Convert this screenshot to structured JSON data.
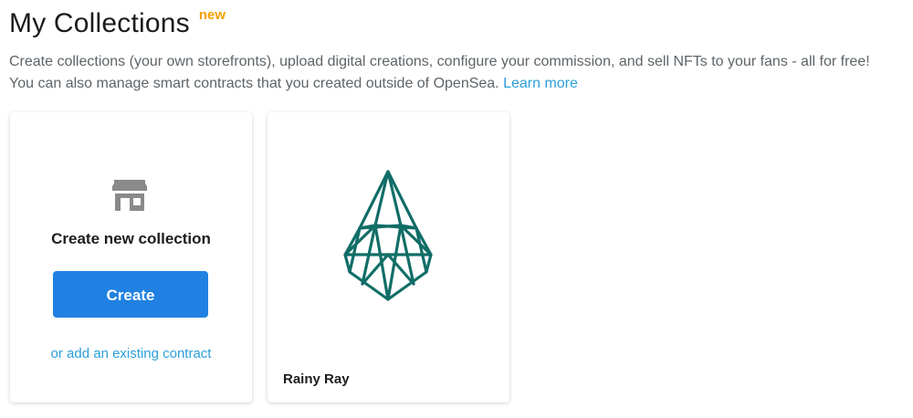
{
  "header": {
    "title": "My Collections",
    "badge": "new"
  },
  "description": {
    "line1": "Create collections (your own storefronts), upload digital creations, configure your commission, and sell NFTs to your fans - all for free!",
    "line2": "You can also manage smart contracts that you created outside of OpenSea.",
    "learn_more": "Learn more"
  },
  "create_card": {
    "icon": "storefront-icon",
    "heading": "Create new collection",
    "button_label": "Create",
    "existing_link": "or add an existing contract"
  },
  "collections": [
    {
      "name": "Rainy Ray",
      "image_icon": "raindrop-crystal-icon"
    }
  ],
  "colors": {
    "accent": "#2081e2",
    "link": "#2b9fd9",
    "badge": "#f4a000",
    "crystal": "#116e67",
    "icon_gray": "#8a8a8a"
  }
}
